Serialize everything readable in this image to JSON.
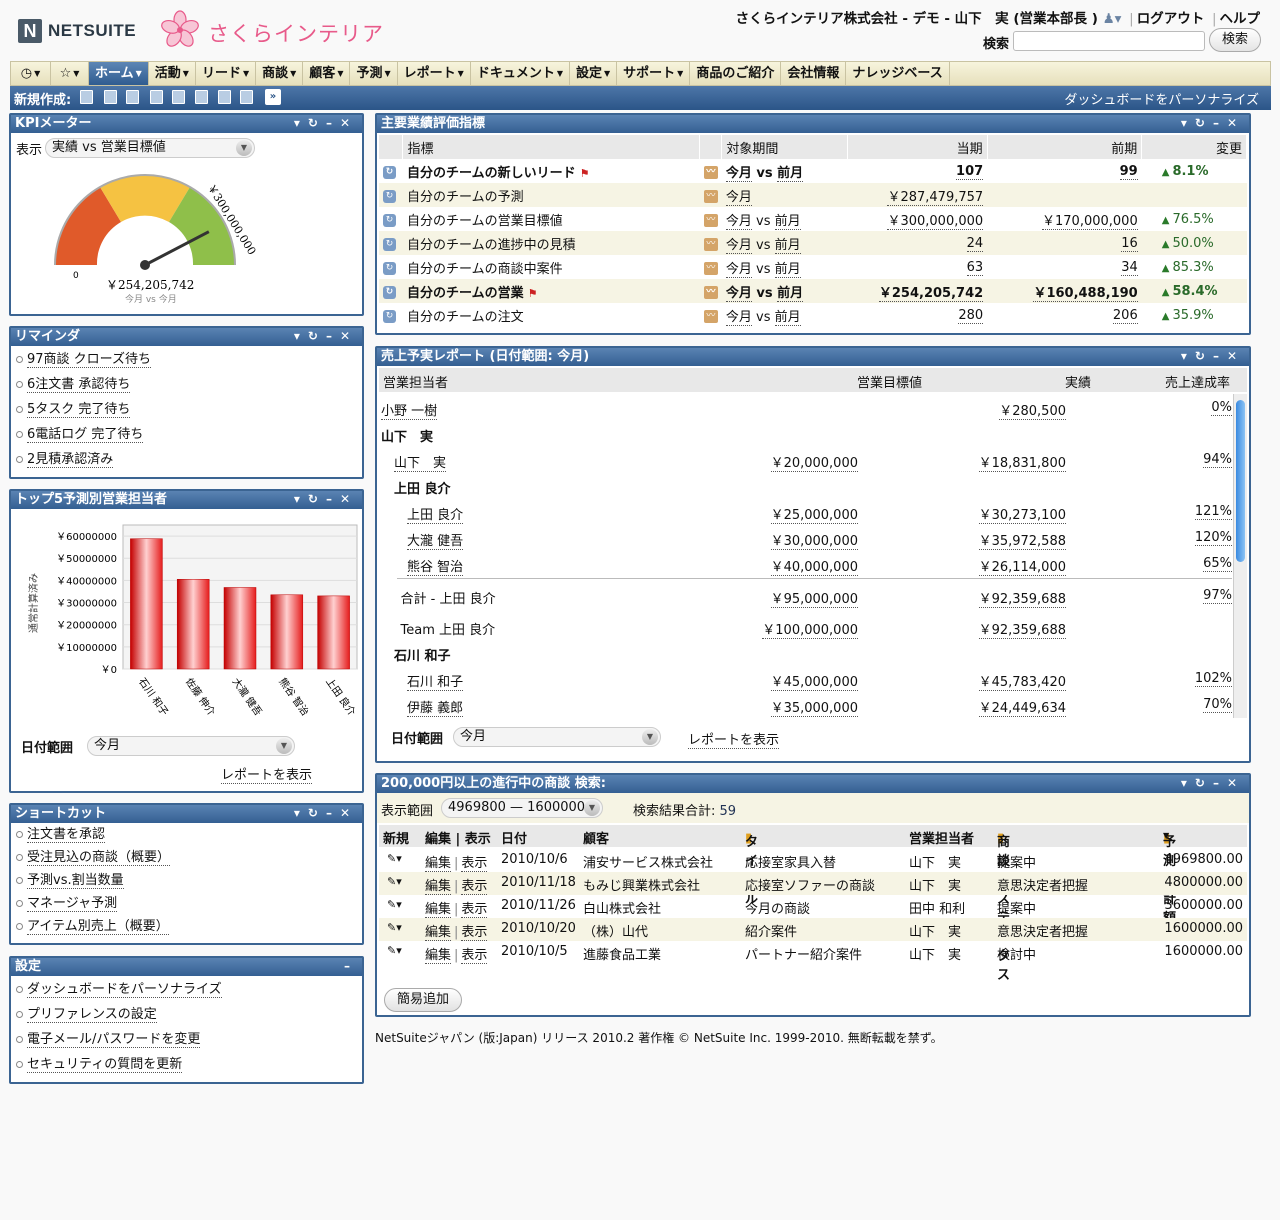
{
  "header": {
    "logo_mark": "N",
    "logo_text": "NETSUITE",
    "brand_name": "さくらインテリア",
    "company": "さくらインテリア株式会社 - デモ - 山下　実 (営業本部長 )",
    "logout": "ログアウト",
    "help": "ヘルプ",
    "search_label": "検索",
    "search_value": "",
    "search_button": "検索"
  },
  "nav": {
    "items": [
      "ホーム",
      "活動",
      "リード",
      "商談",
      "顧客",
      "予測",
      "レポート",
      "ドキュメント",
      "設定",
      "サポート",
      "商品のご紹介",
      "会社情報",
      "ナレッジベース"
    ],
    "carets": [
      true,
      true,
      true,
      true,
      true,
      true,
      true,
      true,
      true,
      true,
      false,
      false,
      false
    ]
  },
  "subnav": {
    "new_label": "新規作成:",
    "personalize": "ダッシュボードをパーソナライズ"
  },
  "kpi_meter": {
    "title": "KPIメーター",
    "show_label": "表示",
    "select_value": "実績 vs 営業目標値",
    "gauge_min": "0",
    "gauge_max": "￥300,000,000",
    "gauge_value_text": "￥254,205,742",
    "gauge_fraction": 0.847,
    "gauge_sub": "今月 vs 今月"
  },
  "reminders": {
    "title": "リマインダ",
    "items": [
      "97商談 クローズ待ち",
      "6注文書 承認待ち",
      "5タスク 完了待ち",
      "6電話ログ 完了待ち",
      "2見積承認済み"
    ]
  },
  "top5": {
    "title": "トップ5予測別営業担当者",
    "date_label": "日付範囲",
    "date_value": "今月",
    "report_link": "レポートを表示",
    "chart_data": {
      "type": "bar",
      "ylabel": "通常計算済み",
      "categories": [
        "石川 和子",
        "佐藤 伸介",
        "大瀧 健吾",
        "熊谷 智治",
        "上田 良介"
      ],
      "values": [
        58800000,
        40500000,
        36800000,
        33500000,
        33000000
      ],
      "ylim": [
        0,
        65000000
      ],
      "yticks": [
        "￥0",
        "￥10000000",
        "￥20000000",
        "￥30000000",
        "￥40000000",
        "￥50000000",
        "￥60000000"
      ],
      "ytick_values": [
        0,
        10000000,
        20000000,
        30000000,
        40000000,
        50000000,
        60000000
      ],
      "grid": true,
      "bar_color": "#e51c1c"
    }
  },
  "shortcuts": {
    "title": "ショートカット",
    "items": [
      "注文書を承認",
      "受注見込の商談（概要）",
      "予測vs.割当数量",
      "マネージャ予測",
      "アイテム別売上（概要）"
    ]
  },
  "settings": {
    "title": "設定",
    "items": [
      "ダッシュボードをパーソナライズ",
      "プリファレンスの設定",
      "電子メール/パスワードを変更",
      "セキュリティの質問を更新"
    ]
  },
  "kpi": {
    "title": "主要業績評価指標",
    "headers": [
      "指標",
      "対象期間",
      "当期",
      "前期",
      "変更"
    ],
    "rows": [
      {
        "name": "自分のチームの新しいリード",
        "period_a": "今月",
        "vs": " vs ",
        "period_b": "前月",
        "cur": "107",
        "prev": "99",
        "chg": "8.1%",
        "bold": true,
        "flag": true
      },
      {
        "name": "自分のチームの予測",
        "period_a": "今月",
        "vs": "",
        "period_b": "",
        "cur": "￥287,479,757",
        "prev": "",
        "chg": "",
        "bold": false,
        "flag": false
      },
      {
        "name": "自分のチームの営業目標値",
        "period_a": "今月",
        "vs": " vs ",
        "period_b": "前月",
        "cur": "￥300,000,000",
        "prev": "￥170,000,000",
        "chg": "76.5%",
        "bold": false,
        "flag": false
      },
      {
        "name": "自分のチームの進捗中の見積",
        "period_a": "今月",
        "vs": " vs ",
        "period_b": "前月",
        "cur": "24",
        "prev": "16",
        "chg": "50.0%",
        "bold": false,
        "flag": false
      },
      {
        "name": "自分のチームの商談中案件",
        "period_a": "今月",
        "vs": " vs ",
        "period_b": "前月",
        "cur": "63",
        "prev": "34",
        "chg": "85.3%",
        "bold": false,
        "flag": false
      },
      {
        "name": "自分のチームの営業",
        "period_a": "今月",
        "vs": " vs ",
        "period_b": "前月",
        "cur": "￥254,205,742",
        "prev": "￥160,488,190",
        "chg": "58.4%",
        "bold": true,
        "flag": true
      },
      {
        "name": "自分のチームの注文",
        "period_a": "今月",
        "vs": " vs ",
        "period_b": "前月",
        "cur": "280",
        "prev": "206",
        "chg": "35.9%",
        "bold": false,
        "flag": false
      }
    ]
  },
  "sales_report": {
    "title": "売上予実レポート (日付範囲: 今月)",
    "headers": [
      "営業担当者",
      "営業目標値",
      "実績",
      "売上達成率"
    ],
    "rows": [
      {
        "name": "小野 一樹",
        "target": "",
        "actual": "￥280,500",
        "rate": "0%",
        "indent": 0,
        "bold": false,
        "link": true
      },
      {
        "name": "山下　実",
        "target": "",
        "actual": "",
        "rate": "",
        "indent": 0,
        "bold": true,
        "link": false
      },
      {
        "name": "山下　実",
        "target": "￥20,000,000",
        "actual": "￥18,831,800",
        "rate": "94%",
        "indent": 1,
        "bold": false,
        "link": true
      },
      {
        "name": "上田 良介",
        "target": "",
        "actual": "",
        "rate": "",
        "indent": 1,
        "bold": true,
        "link": false
      },
      {
        "name": "上田 良介",
        "target": "￥25,000,000",
        "actual": "￥30,273,100",
        "rate": "121%",
        "indent": 2,
        "bold": false,
        "link": true
      },
      {
        "name": "大瀧 健吾",
        "target": "￥30,000,000",
        "actual": "￥35,972,588",
        "rate": "120%",
        "indent": 2,
        "bold": false,
        "link": true
      },
      {
        "name": "熊谷 智治",
        "target": "￥40,000,000",
        "actual": "￥26,114,000",
        "rate": "65%",
        "indent": 2,
        "bold": false,
        "link": true
      },
      {
        "name": "合計 - 上田 良介",
        "target": "￥95,000,000",
        "actual": "￥92,359,688",
        "rate": "97%",
        "indent": 1.5,
        "bold": false,
        "link": false
      },
      {
        "name": "Team 上田 良介",
        "target": "￥100,000,000",
        "actual": "￥92,359,688",
        "rate": "",
        "indent": 1.5,
        "bold": false,
        "link": false
      },
      {
        "name": "石川 和子",
        "target": "",
        "actual": "",
        "rate": "",
        "indent": 1,
        "bold": true,
        "link": false
      },
      {
        "name": "石川 和子",
        "target": "￥45,000,000",
        "actual": "￥45,783,420",
        "rate": "102%",
        "indent": 2,
        "bold": false,
        "link": true
      },
      {
        "name": "伊藤 義郎",
        "target": "￥35,000,000",
        "actual": "￥24,449,634",
        "rate": "70%",
        "indent": 2,
        "bold": false,
        "link": true
      }
    ],
    "date_label": "日付範囲",
    "date_value": "今月",
    "report_link": "レポートを表示"
  },
  "deals": {
    "title": "200,000円以上の進行中の商談 検索:",
    "range_label": "表示範囲",
    "range_value": "4969800 — 1600000",
    "total_label": "検索結果合計:",
    "total_value": "59",
    "headers": [
      "新規",
      "編集 | 表示",
      "日付",
      "顧客",
      "タイトル",
      "営業担当者",
      "商談のステータス",
      "予測合計額"
    ],
    "edit": "編集",
    "view": "表示",
    "rows": [
      {
        "date": "2010/10/6",
        "customer": "浦安サービス株式会社",
        "title": "応接室家具入替",
        "rep": "山下　実",
        "status": "提案中",
        "amount": "4969800.00"
      },
      {
        "date": "2010/11/18",
        "customer": "もみじ興業株式会社",
        "title": "応接室ソファーの商談",
        "rep": "山下　実",
        "status": "意思決定者把握",
        "amount": "4800000.00"
      },
      {
        "date": "2010/11/26",
        "customer": "白山株式会社",
        "title": "今月の商談",
        "rep": "田中 和利",
        "status": "提案中",
        "amount": "3600000.00"
      },
      {
        "date": "2010/10/20",
        "customer": "（株）山代",
        "title": "紹介案件",
        "rep": "山下　実",
        "status": "意思決定者把握",
        "amount": "1600000.00"
      },
      {
        "date": "2010/10/5",
        "customer": "進藤食品工業",
        "title": "パートナー紹介案件",
        "rep": "山下　実",
        "status": "検討中",
        "amount": "1600000.00"
      }
    ],
    "quick_add": "簡易追加"
  },
  "footer": "NetSuiteジャパン (版:Japan) リリース 2010.2 著作権 © NetSuite Inc. 1999-2010. 無断転載を禁ず。"
}
